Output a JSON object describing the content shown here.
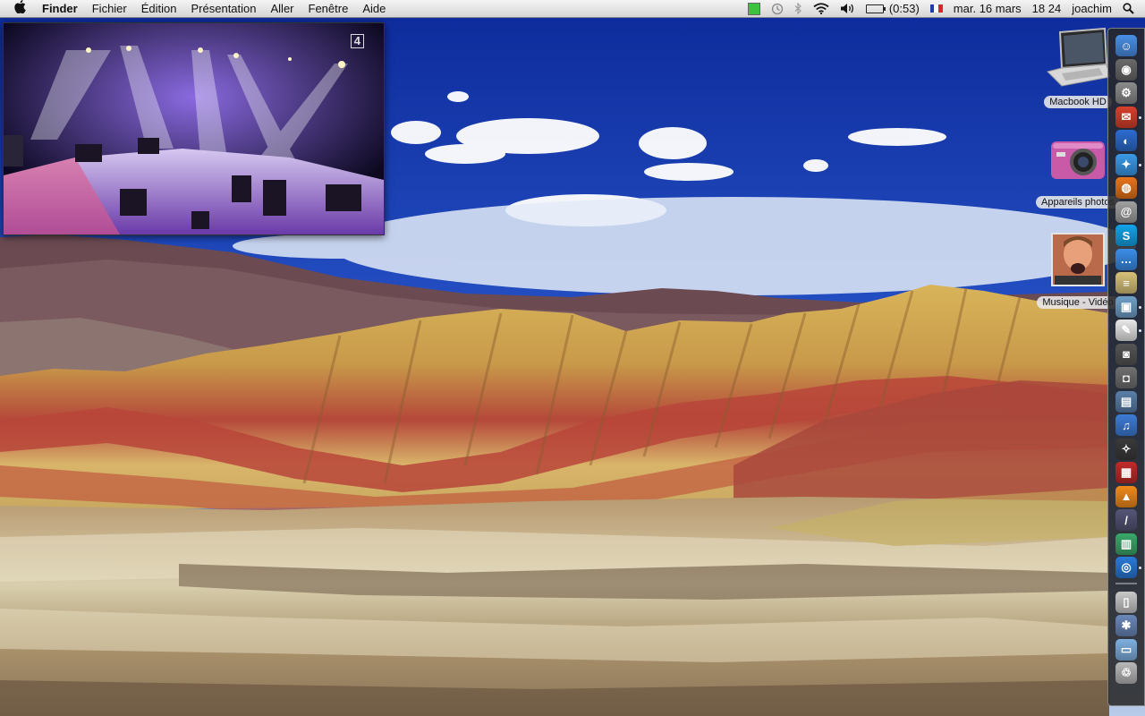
{
  "menubar": {
    "apple_icon": "",
    "app": "Finder",
    "items": [
      "Fichier",
      "Édition",
      "Présentation",
      "Aller",
      "Fenêtre",
      "Aide"
    ],
    "battery_time": "(0:53)",
    "date": "mar. 16 mars",
    "time": "18 24",
    "user": "joachim",
    "icons": [
      "activity-meter-icon",
      "time-machine-icon",
      "bluetooth-icon",
      "wifi-icon",
      "volume-icon",
      "battery-icon",
      "french-flag-icon",
      "spotlight-icon"
    ]
  },
  "video": {
    "channel_logo": "4"
  },
  "desktop": {
    "icons": [
      {
        "label": "Macbook HD",
        "icon": "laptop-icon"
      },
      {
        "label": "Appareils photos",
        "icon": "camera-icon"
      },
      {
        "label": "Musique - Vidéo",
        "icon": "music-video-icon"
      }
    ]
  },
  "dock": {
    "items": [
      {
        "name": "finder",
        "color": "#4a8fe6",
        "glyph": "☺"
      },
      {
        "name": "dashboard",
        "color": "#6a6a6a",
        "glyph": "◉"
      },
      {
        "name": "system-preferences",
        "color": "#8b8b8b",
        "glyph": "⚙"
      },
      {
        "name": "mail",
        "color": "#d7402c",
        "glyph": "✉"
      },
      {
        "name": "network",
        "color": "#2d6cd0",
        "glyph": "◐"
      },
      {
        "name": "safari",
        "color": "#3a9ae8",
        "glyph": "✦"
      },
      {
        "name": "firefox",
        "color": "#e8741a",
        "glyph": "◍"
      },
      {
        "name": "address-book",
        "color": "#a0a0a0",
        "glyph": "@"
      },
      {
        "name": "skype",
        "color": "#13a3e8",
        "glyph": "S"
      },
      {
        "name": "ichat",
        "color": "#3b8ee8",
        "glyph": "…"
      },
      {
        "name": "stickies",
        "color": "#d8c27a",
        "glyph": "≡"
      },
      {
        "name": "preview",
        "color": "#6fa0c8",
        "glyph": "▣"
      },
      {
        "name": "textedit",
        "color": "#e8e8e8",
        "glyph": "✎"
      },
      {
        "name": "photo-booth",
        "color": "#555555",
        "glyph": "◙"
      },
      {
        "name": "image-capture",
        "color": "#707070",
        "glyph": "◘"
      },
      {
        "name": "iphoto",
        "color": "#5a7fa8",
        "glyph": "▤"
      },
      {
        "name": "itunes",
        "color": "#3e7cd6",
        "glyph": "♫"
      },
      {
        "name": "spaces",
        "color": "#3a3a3a",
        "glyph": "✧"
      },
      {
        "name": "photo-app",
        "color": "#c22a2a",
        "glyph": "▦"
      },
      {
        "name": "vlc",
        "color": "#f08a1a",
        "glyph": "▲"
      },
      {
        "name": "utility",
        "color": "#555577",
        "glyph": "/"
      },
      {
        "name": "chart-app",
        "color": "#3aa86a",
        "glyph": "▥"
      },
      {
        "name": "browser-globe",
        "color": "#2a7ad8",
        "glyph": "◎"
      },
      {
        "name": "documents",
        "color": "#c8c8c8",
        "glyph": "▯"
      },
      {
        "name": "network-stack",
        "color": "#6a88b8",
        "glyph": "✱"
      },
      {
        "name": "folder",
        "color": "#7fb0e0",
        "glyph": "▭"
      },
      {
        "name": "trash",
        "color": "#b8b8b8",
        "glyph": "♲"
      }
    ]
  }
}
